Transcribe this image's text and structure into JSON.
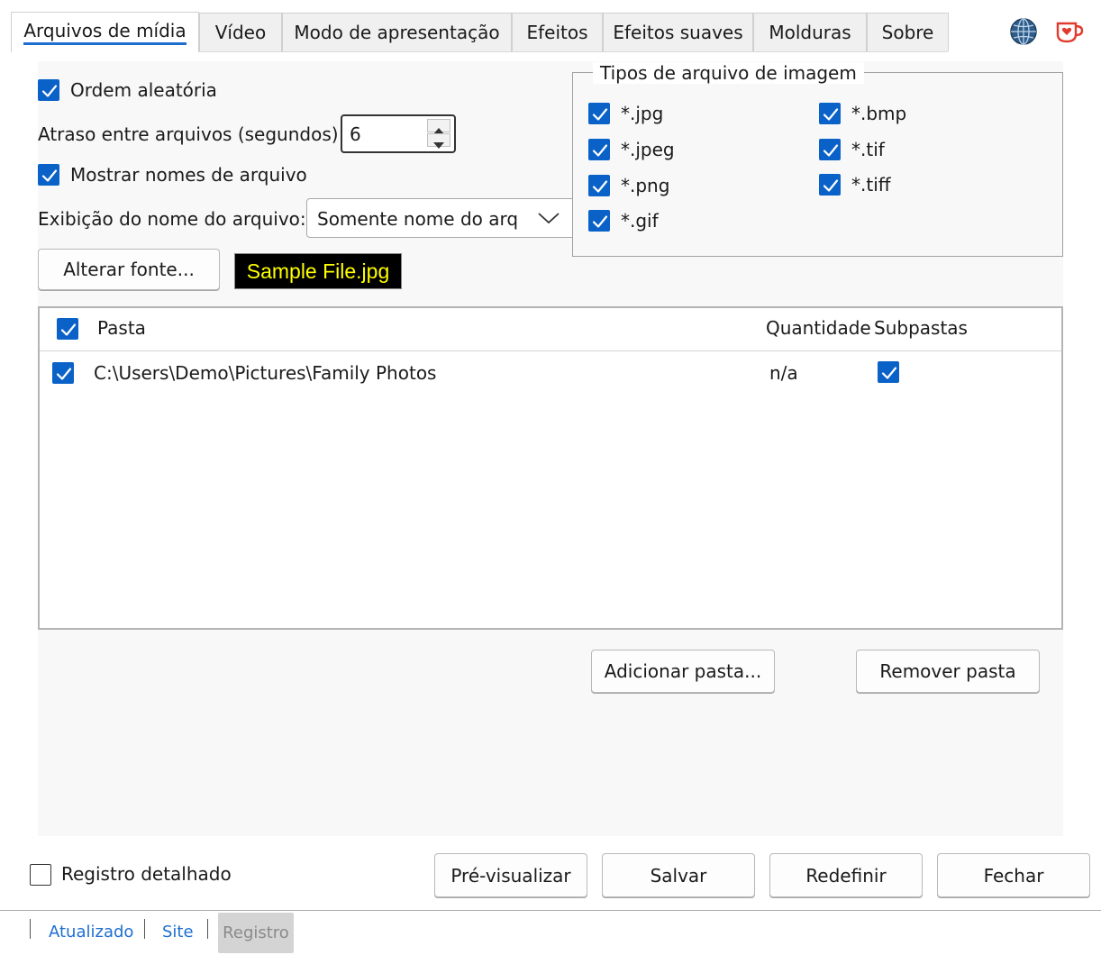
{
  "tabs": [
    {
      "label": "Arquivos de mídia",
      "active": true
    },
    {
      "label": "Vídeo"
    },
    {
      "label": "Modo de apresentação"
    },
    {
      "label": "Efeitos"
    },
    {
      "label": "Efeitos suaves"
    },
    {
      "label": "Molduras"
    },
    {
      "label": "Sobre"
    }
  ],
  "icons": {
    "language": "globe-icon",
    "donate": "coffee-heart-icon"
  },
  "options": {
    "shuffle_label": "Ordem aleatória",
    "shuffle_checked": true,
    "delay_label": "Atraso entre arquivos (segundos):",
    "delay_value": "6",
    "show_names_label": "Mostrar nomes de arquivo",
    "show_names_checked": true,
    "name_display_label": "Exibição do nome do arquivo:",
    "name_display_value": "Somente nome do arq",
    "change_font_label": "Alterar fonte...",
    "font_sample": "Sample File.jpg"
  },
  "file_types": {
    "title": "Tipos de arquivo de imagem",
    "items": [
      {
        "label": "*.jpg",
        "checked": true
      },
      {
        "label": "*.jpeg",
        "checked": true
      },
      {
        "label": "*.png",
        "checked": true
      },
      {
        "label": "*.gif",
        "checked": true
      },
      {
        "label": "*.bmp",
        "checked": true
      },
      {
        "label": "*.tif",
        "checked": true
      },
      {
        "label": "*.tiff",
        "checked": true
      }
    ]
  },
  "folders": {
    "columns": {
      "folder": "Pasta",
      "count": "Quantidade",
      "subfolders": "Subpastas"
    },
    "header_checked": true,
    "rows": [
      {
        "checked": true,
        "path": "C:\\Users\\Demo\\Pictures\\Family Photos",
        "count": "n/a",
        "subfolders": true
      }
    ],
    "add_label": "Adicionar pasta...",
    "remove_label": "Remover pasta"
  },
  "footer": {
    "verbose_label": "Registro detalhado",
    "verbose_checked": false,
    "preview_label": "Pré-visualizar",
    "save_label": "Salvar",
    "reset_label": "Redefinir",
    "close_label": "Fechar"
  },
  "status_bar": {
    "updated": "Atualizado",
    "site": "Site",
    "log": "Registro"
  },
  "colors": {
    "accent": "#0a62c8",
    "link": "#1e6fd0",
    "sample_bg": "#000000",
    "sample_fg": "#ffff00"
  }
}
